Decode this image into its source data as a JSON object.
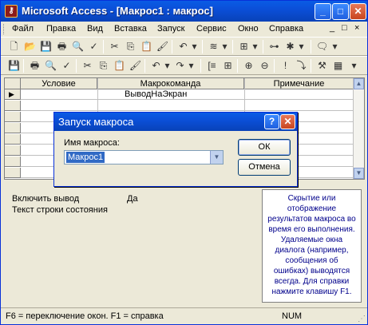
{
  "window": {
    "title": "Microsoft Access - [Макрос1 : макрос]",
    "min_glyph": "_",
    "max_glyph": "□",
    "close_glyph": "✕"
  },
  "menubar": {
    "items": [
      "Файл",
      "Правка",
      "Вид",
      "Вставка",
      "Запуск",
      "Сервис",
      "Окно",
      "Справка"
    ],
    "controls": [
      "_",
      "□",
      "×"
    ]
  },
  "grid": {
    "columns": [
      "Условие",
      "Макрокоманда",
      "Примечание"
    ],
    "rows": [
      {
        "condition": "",
        "action": "ВыводНаЭкран",
        "comment": ""
      }
    ]
  },
  "properties": {
    "fields": [
      {
        "label": "Включить вывод",
        "value": "Да"
      },
      {
        "label": "Текст строки состояния",
        "value": ""
      }
    ],
    "help": "Скрытие или отображение результатов макроса во время его выполнения. Удаляемые окна диалога (например, сообщения об ошибках) выводятся всегда. Для справки нажмите клавишу F1."
  },
  "statusbar": {
    "message": "F6 = переключение окон.  F1 = справка",
    "num": "NUM"
  },
  "dialog": {
    "title": "Запуск макроса",
    "help_glyph": "?",
    "close_glyph": "✕",
    "field_label": "Имя макроса:",
    "field_value": "Макрос1",
    "ok_label": "ОК",
    "cancel_label": "Отмена"
  }
}
